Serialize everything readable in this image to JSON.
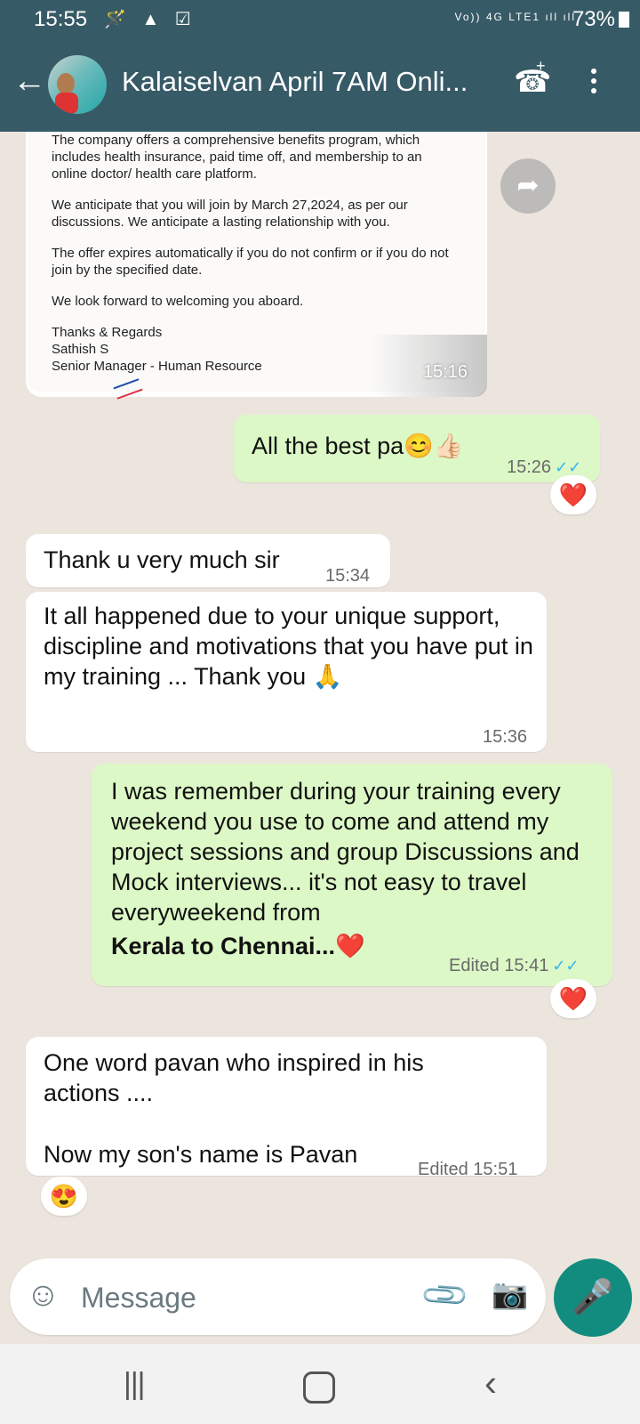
{
  "status_bar": {
    "time": "15:55",
    "left_icons": "🪄 ▲ ☑",
    "network": "Vo)) 4G LTE1 ıll ıll",
    "battery": "73%"
  },
  "header": {
    "title": "Kalaiselvan April 7AM Onli...",
    "back_icon": "←",
    "call_icon": "☎",
    "call_plus": "+",
    "more_icon": "⋮"
  },
  "messages": [
    {
      "type": "document",
      "paragraphs": [
        "The company offers a comprehensive benefits program, which includes health insurance, paid time off, and membership to an online doctor/ health care platform.",
        "We anticipate that you will join by March 27,2024, as per our discussions. We anticipate a lasting relationship with you.",
        "The offer expires automatically if you do not confirm or if you do not join by the specified date.",
        "We look forward to welcoming you aboard."
      ],
      "signature": [
        "Thanks & Regards",
        "Sathish S",
        "Senior Manager - Human Resource"
      ],
      "time": "15:16"
    },
    {
      "type": "outgoing",
      "text": "All the best pa😊👍🏻",
      "time": "15:26",
      "status": "✓✓",
      "reaction": "❤️"
    },
    {
      "type": "incoming",
      "text": "Thank u very much sir",
      "time": "15:34"
    },
    {
      "type": "incoming",
      "text": "It all happened due to your unique support, discipline and motivations that you have put in  my training ... Thank you 🙏",
      "time": "15:36"
    },
    {
      "type": "outgoing",
      "text": "I was remember during your training every weekend you use to come and attend my project sessions and group Discussions and Mock interviews... it's not easy to travel everyweekend from",
      "bold_text": "Kerala to Chennai...❤️",
      "time": "Edited 15:41",
      "status": "✓✓",
      "reaction": "❤️"
    },
    {
      "type": "incoming",
      "text_line1": "One word pavan who inspired in his actions ....",
      "text_line2": "Now my son's name is Pavan",
      "time": "Edited 15:51",
      "reaction": "😍"
    }
  ],
  "input": {
    "placeholder": "Message",
    "emoji_icon": "☺",
    "attach_icon": "📎",
    "camera_icon": "📷",
    "mic_icon": "🎤",
    "forward_icon": "➦"
  },
  "nav": {
    "recents": "|||",
    "back": "‹"
  }
}
